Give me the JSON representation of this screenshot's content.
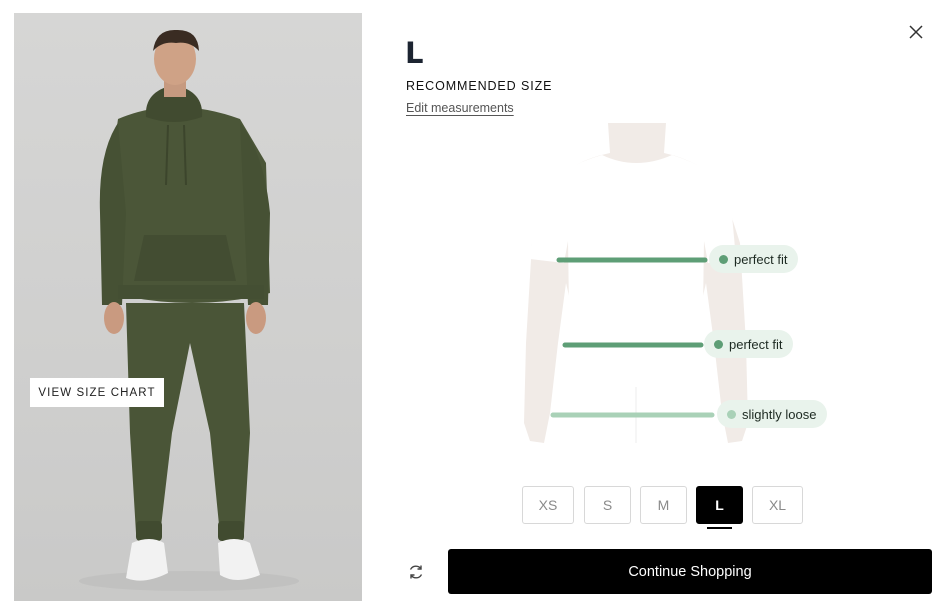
{
  "product": {
    "view_size_chart_label": "VIEW SIZE CHART",
    "garment_color": "#4b5638"
  },
  "recommendation": {
    "size": "L",
    "label": "RECOMMENDED SIZE",
    "edit_link": "Edit measurements"
  },
  "fit_indicators": [
    {
      "area": "chest",
      "text": "perfect fit",
      "color": "#5e9e76"
    },
    {
      "area": "waist",
      "text": "perfect fit",
      "color": "#5e9e76"
    },
    {
      "area": "hips",
      "text": "slightly loose",
      "color": "#a9d1b7"
    }
  ],
  "size_options": [
    "XS",
    "S",
    "M",
    "L",
    "XL"
  ],
  "selected_size": "L",
  "actions": {
    "continue_label": "Continue Shopping"
  },
  "icons": {
    "close": "close-icon",
    "refresh": "refresh-icon"
  }
}
